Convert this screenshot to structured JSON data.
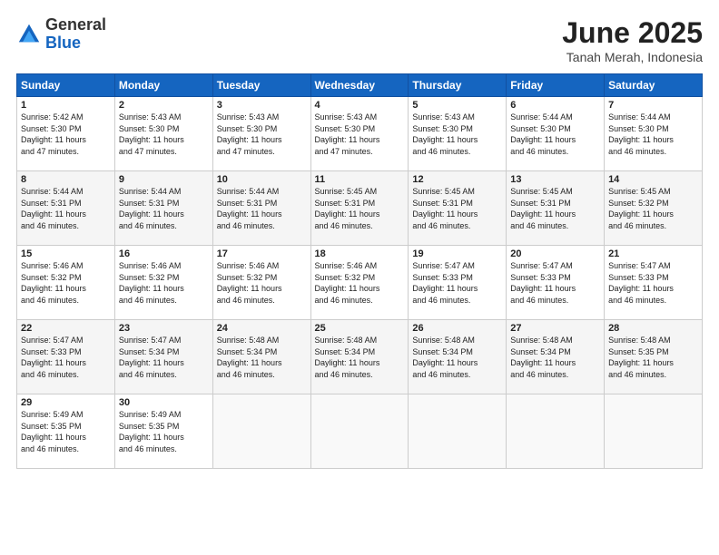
{
  "logo": {
    "general": "General",
    "blue": "Blue"
  },
  "title": "June 2025",
  "location": "Tanah Merah, Indonesia",
  "weekdays": [
    "Sunday",
    "Monday",
    "Tuesday",
    "Wednesday",
    "Thursday",
    "Friday",
    "Saturday"
  ],
  "weeks": [
    [
      {
        "day": "1",
        "info": "Sunrise: 5:42 AM\nSunset: 5:30 PM\nDaylight: 11 hours\nand 47 minutes."
      },
      {
        "day": "2",
        "info": "Sunrise: 5:43 AM\nSunset: 5:30 PM\nDaylight: 11 hours\nand 47 minutes."
      },
      {
        "day": "3",
        "info": "Sunrise: 5:43 AM\nSunset: 5:30 PM\nDaylight: 11 hours\nand 47 minutes."
      },
      {
        "day": "4",
        "info": "Sunrise: 5:43 AM\nSunset: 5:30 PM\nDaylight: 11 hours\nand 47 minutes."
      },
      {
        "day": "5",
        "info": "Sunrise: 5:43 AM\nSunset: 5:30 PM\nDaylight: 11 hours\nand 46 minutes."
      },
      {
        "day": "6",
        "info": "Sunrise: 5:44 AM\nSunset: 5:30 PM\nDaylight: 11 hours\nand 46 minutes."
      },
      {
        "day": "7",
        "info": "Sunrise: 5:44 AM\nSunset: 5:30 PM\nDaylight: 11 hours\nand 46 minutes."
      }
    ],
    [
      {
        "day": "8",
        "info": "Sunrise: 5:44 AM\nSunset: 5:31 PM\nDaylight: 11 hours\nand 46 minutes."
      },
      {
        "day": "9",
        "info": "Sunrise: 5:44 AM\nSunset: 5:31 PM\nDaylight: 11 hours\nand 46 minutes."
      },
      {
        "day": "10",
        "info": "Sunrise: 5:44 AM\nSunset: 5:31 PM\nDaylight: 11 hours\nand 46 minutes."
      },
      {
        "day": "11",
        "info": "Sunrise: 5:45 AM\nSunset: 5:31 PM\nDaylight: 11 hours\nand 46 minutes."
      },
      {
        "day": "12",
        "info": "Sunrise: 5:45 AM\nSunset: 5:31 PM\nDaylight: 11 hours\nand 46 minutes."
      },
      {
        "day": "13",
        "info": "Sunrise: 5:45 AM\nSunset: 5:31 PM\nDaylight: 11 hours\nand 46 minutes."
      },
      {
        "day": "14",
        "info": "Sunrise: 5:45 AM\nSunset: 5:32 PM\nDaylight: 11 hours\nand 46 minutes."
      }
    ],
    [
      {
        "day": "15",
        "info": "Sunrise: 5:46 AM\nSunset: 5:32 PM\nDaylight: 11 hours\nand 46 minutes."
      },
      {
        "day": "16",
        "info": "Sunrise: 5:46 AM\nSunset: 5:32 PM\nDaylight: 11 hours\nand 46 minutes."
      },
      {
        "day": "17",
        "info": "Sunrise: 5:46 AM\nSunset: 5:32 PM\nDaylight: 11 hours\nand 46 minutes."
      },
      {
        "day": "18",
        "info": "Sunrise: 5:46 AM\nSunset: 5:32 PM\nDaylight: 11 hours\nand 46 minutes."
      },
      {
        "day": "19",
        "info": "Sunrise: 5:47 AM\nSunset: 5:33 PM\nDaylight: 11 hours\nand 46 minutes."
      },
      {
        "day": "20",
        "info": "Sunrise: 5:47 AM\nSunset: 5:33 PM\nDaylight: 11 hours\nand 46 minutes."
      },
      {
        "day": "21",
        "info": "Sunrise: 5:47 AM\nSunset: 5:33 PM\nDaylight: 11 hours\nand 46 minutes."
      }
    ],
    [
      {
        "day": "22",
        "info": "Sunrise: 5:47 AM\nSunset: 5:33 PM\nDaylight: 11 hours\nand 46 minutes."
      },
      {
        "day": "23",
        "info": "Sunrise: 5:47 AM\nSunset: 5:34 PM\nDaylight: 11 hours\nand 46 minutes."
      },
      {
        "day": "24",
        "info": "Sunrise: 5:48 AM\nSunset: 5:34 PM\nDaylight: 11 hours\nand 46 minutes."
      },
      {
        "day": "25",
        "info": "Sunrise: 5:48 AM\nSunset: 5:34 PM\nDaylight: 11 hours\nand 46 minutes."
      },
      {
        "day": "26",
        "info": "Sunrise: 5:48 AM\nSunset: 5:34 PM\nDaylight: 11 hours\nand 46 minutes."
      },
      {
        "day": "27",
        "info": "Sunrise: 5:48 AM\nSunset: 5:34 PM\nDaylight: 11 hours\nand 46 minutes."
      },
      {
        "day": "28",
        "info": "Sunrise: 5:48 AM\nSunset: 5:35 PM\nDaylight: 11 hours\nand 46 minutes."
      }
    ],
    [
      {
        "day": "29",
        "info": "Sunrise: 5:49 AM\nSunset: 5:35 PM\nDaylight: 11 hours\nand 46 minutes."
      },
      {
        "day": "30",
        "info": "Sunrise: 5:49 AM\nSunset: 5:35 PM\nDaylight: 11 hours\nand 46 minutes."
      },
      {
        "day": "",
        "info": ""
      },
      {
        "day": "",
        "info": ""
      },
      {
        "day": "",
        "info": ""
      },
      {
        "day": "",
        "info": ""
      },
      {
        "day": "",
        "info": ""
      }
    ]
  ]
}
